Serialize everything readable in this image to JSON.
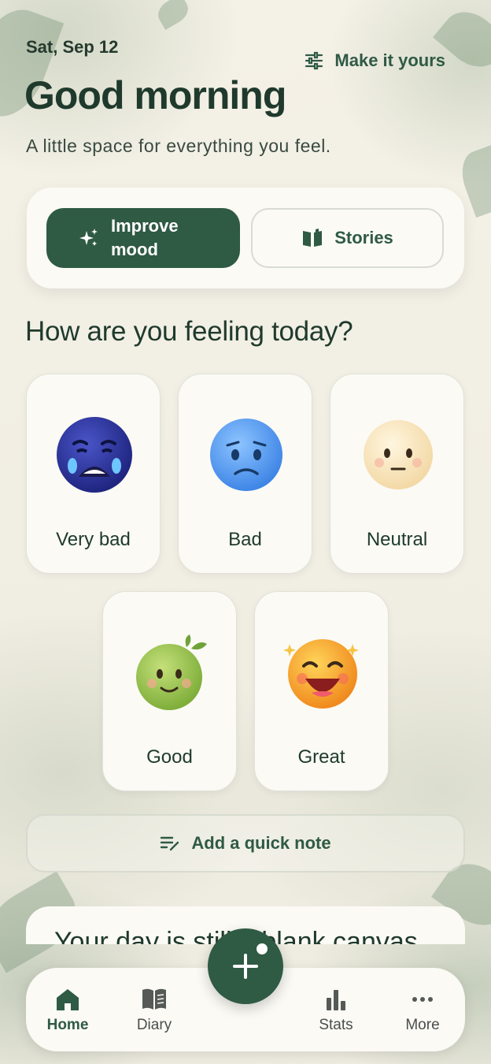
{
  "header": {
    "date": "Sat, Sep 12",
    "customize_label": "Make it yours",
    "greeting": "Good morning",
    "subtitle": "A little space for everything you feel."
  },
  "actions": {
    "improve_label": "Improve mood",
    "stories_label": "Stories"
  },
  "mood_section": {
    "question": "How are you feeling today?",
    "moods": [
      {
        "label": "Very bad",
        "icon": "crying-face-icon"
      },
      {
        "label": "Bad",
        "icon": "sad-face-icon"
      },
      {
        "label": "Neutral",
        "icon": "neutral-face-icon"
      },
      {
        "label": "Good",
        "icon": "smiling-face-icon"
      },
      {
        "label": "Great",
        "icon": "grinning-face-icon"
      }
    ]
  },
  "quick_note": {
    "label": "Add a quick note"
  },
  "day_card": {
    "text": "Your day is still a blank canvas"
  },
  "nav": {
    "items": [
      {
        "label": "Home",
        "icon": "home-icon"
      },
      {
        "label": "Diary",
        "icon": "book-icon"
      },
      {
        "label": "Stats",
        "icon": "bar-chart-icon"
      },
      {
        "label": "More",
        "icon": "more-dots-icon"
      }
    ],
    "fab_icon": "plus-icon"
  },
  "colors": {
    "primary": "#2f5a44",
    "background": "#f3f0e6",
    "card": "#fbfaf5",
    "text": "#1f3a2c"
  }
}
